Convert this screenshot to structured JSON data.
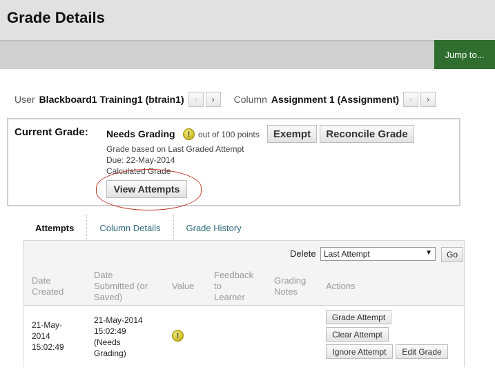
{
  "header": {
    "title": "Grade Details",
    "jump_label": "Jump to..."
  },
  "nav": {
    "user_label": "User",
    "user_value": "Blackboard1 Training1 (btrain1)",
    "column_label": "Column",
    "column_value": "Assignment 1 (Assignment)",
    "prev_arrow": "‹",
    "next_arrow": "›"
  },
  "current_grade": {
    "label": "Current Grade:",
    "value": "Needs Grading",
    "icon": "needs-grading-icon",
    "out_of": "out of 100 points",
    "exempt_label": "Exempt",
    "reconcile_label": "Reconcile Grade",
    "based_on": "Grade based on Last Graded Attempt",
    "due": "Due: 22-May-2014",
    "calculated": "Calculated Grade",
    "view_attempts_label": "View Attempts"
  },
  "tabs": [
    {
      "label": "Attempts",
      "active": true
    },
    {
      "label": "Column Details",
      "active": false
    },
    {
      "label": "Grade History",
      "active": false
    }
  ],
  "attempts": {
    "delete_label": "Delete",
    "delete_select_value": "Last Attempt",
    "go_label": "Go",
    "columns": [
      "Date\nCreated",
      "Date\nSubmitted (or\nSaved)",
      "Value",
      "Feedback\nto\nLearner",
      "Grading\nNotes",
      "Actions"
    ],
    "rows": [
      {
        "date_created": "21-May-\n2014\n15:02:49",
        "date_submitted": "21-May-2014\n15:02:49\n(Needs\nGrading)",
        "value_icon": "needs-grading-icon",
        "actions": {
          "grade_attempt": "Grade Attempt",
          "clear_attempt": "Clear Attempt",
          "ignore_attempt": "Ignore Attempt",
          "edit_grade": "Edit Grade"
        }
      }
    ]
  },
  "colors": {
    "jump_bg": "#2f6e2f",
    "tab_link": "#2b6a7c",
    "annotation_circle": "#c0392b",
    "warning_icon": "#c9b824"
  }
}
